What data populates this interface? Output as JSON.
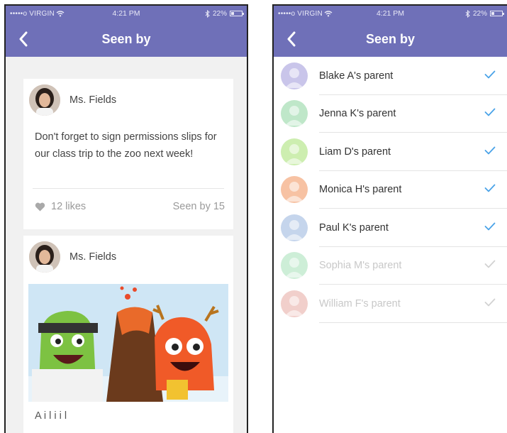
{
  "status": {
    "carrier": "•••••o VIRGIN",
    "time": "4:21 PM",
    "battery": "22%"
  },
  "left": {
    "title": "Seen by",
    "posts": [
      {
        "author": "Ms. Fields",
        "text": "Don't forget to sign permissions slips for our class trip to the zoo next week!",
        "likes": "12 likes",
        "seen": "Seen by 15"
      },
      {
        "author": "Ms. Fields",
        "text_cut": "A      i         l    i   i          l"
      }
    ]
  },
  "right": {
    "title": "Seen by",
    "parents": [
      {
        "label": "Blake A's parent",
        "seen": true,
        "avatar_color": "#c9c5ea"
      },
      {
        "label": "Jenna K's parent",
        "seen": true,
        "avatar_color": "#bfe7c9"
      },
      {
        "label": "Liam D's parent",
        "seen": true,
        "avatar_color": "#cdeeb0"
      },
      {
        "label": "Monica H's parent",
        "seen": true,
        "avatar_color": "#f7c2a3"
      },
      {
        "label": "Paul K's parent",
        "seen": true,
        "avatar_color": "#c5d5ec"
      },
      {
        "label": "Sophia M's parent",
        "seen": false,
        "avatar_color": "#cdeed7"
      },
      {
        "label": "William F's parent",
        "seen": false,
        "avatar_color": "#f1cfcb"
      }
    ]
  },
  "colors": {
    "header": "#6f70b8",
    "check": "#4aa3e8",
    "check_dim": "#d2d2d2"
  }
}
